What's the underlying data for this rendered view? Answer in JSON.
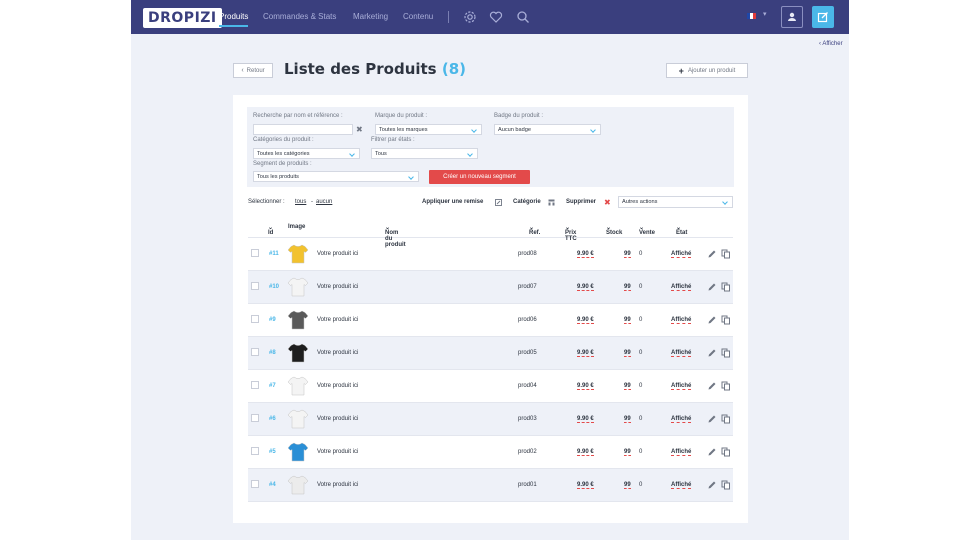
{
  "nav": {
    "logo": "DROPIZI",
    "items": [
      "Produits",
      "Commandes & Stats",
      "Marketing",
      "Contenu"
    ],
    "icons": [
      "gear-icon",
      "heart-icon",
      "search-icon"
    ],
    "language_caret": "▾"
  },
  "sidebar_toggle": "‹ Afficher",
  "header": {
    "back_label": "Retour",
    "title": "Liste des Produits",
    "count": "(8)",
    "add_label": "Ajouter un produit"
  },
  "filters": {
    "search_label": "Recherche par nom et référence :",
    "search_value": "",
    "brand_label": "Marque du produit :",
    "brand_value": "Toutes les marques",
    "badge_label": "Badge du produit :",
    "badge_value": "Aucun badge",
    "category_label": "Catégories du produit :",
    "category_value": "Toutes les catégories",
    "state_label": "Filtrer par états :",
    "state_value": "Tous",
    "segment_label": "Segment de produits :",
    "segment_value": "Tous les produits",
    "create_segment_label": "Créer un nouveau segment"
  },
  "bulk": {
    "select_label": "Sélectionner :",
    "select_all": "tous",
    "dash": "-",
    "select_none": "aucun",
    "apply_discount": "Appliquer une remise",
    "category": "Catégorie",
    "delete": "Supprimer",
    "other_actions": "Autres actions"
  },
  "columns": {
    "id": "Id",
    "image": "Image",
    "name": "Nom du produit",
    "ref": "Ref.",
    "price": "Prix TTC",
    "stock": "Stock",
    "sales": "Vente",
    "state": "Etat"
  },
  "products": [
    {
      "id": "#11",
      "name": "Votre produit ici",
      "ref": "prod08",
      "price": "9.90 €",
      "stock": "99",
      "sales": "0",
      "state": "Affiché",
      "color": "#f2c22e"
    },
    {
      "id": "#10",
      "name": "Votre produit ici",
      "ref": "prod07",
      "price": "9.90 €",
      "stock": "99",
      "sales": "0",
      "state": "Affiché",
      "color": "#f4f4f4"
    },
    {
      "id": "#9",
      "name": "Votre produit ici",
      "ref": "prod06",
      "price": "9.90 €",
      "stock": "99",
      "sales": "0",
      "state": "Affiché",
      "color": "#5a5a5a"
    },
    {
      "id": "#8",
      "name": "Votre produit ici",
      "ref": "prod05",
      "price": "9.90 €",
      "stock": "99",
      "sales": "0",
      "state": "Affiché",
      "color": "#1e1e1e"
    },
    {
      "id": "#7",
      "name": "Votre produit ici",
      "ref": "prod04",
      "price": "9.90 €",
      "stock": "99",
      "sales": "0",
      "state": "Affiché",
      "color": "#f4f4f4"
    },
    {
      "id": "#6",
      "name": "Votre produit ici",
      "ref": "prod03",
      "price": "9.90 €",
      "stock": "99",
      "sales": "0",
      "state": "Affiché",
      "color": "#f4f4f4"
    },
    {
      "id": "#5",
      "name": "Votre produit ici",
      "ref": "prod02",
      "price": "9.90 €",
      "stock": "99",
      "sales": "0",
      "state": "Affiché",
      "color": "#2a8fd6"
    },
    {
      "id": "#4",
      "name": "Votre produit ici",
      "ref": "prod01",
      "price": "9.90 €",
      "stock": "99",
      "sales": "0",
      "state": "Affiché",
      "color": "#ececec"
    }
  ],
  "colors": {
    "topbar": "#3a3f7e",
    "accent": "#4ab7e8",
    "danger": "#e34a4a",
    "background": "#eef1f8"
  }
}
